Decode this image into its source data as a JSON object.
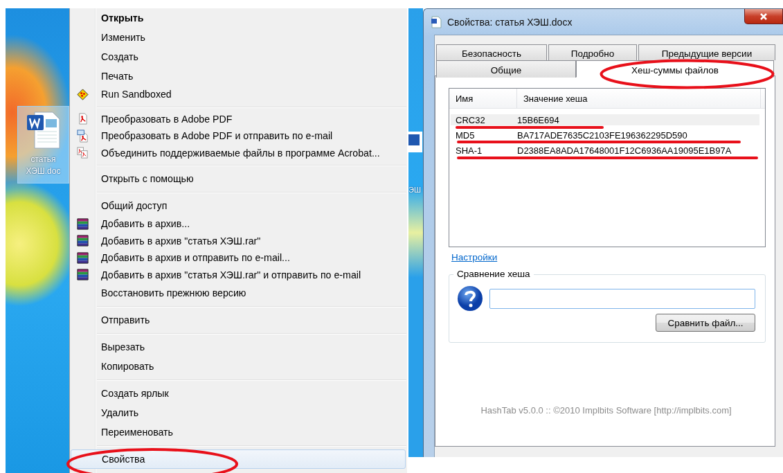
{
  "desktop": {
    "icons": [
      {
        "label": "статья ХЭШ.doc",
        "selected": true
      }
    ],
    "partial_icon_label": "ЭШ"
  },
  "context_menu": {
    "groups": [
      {
        "items": [
          {
            "label": "Открыть",
            "default": true,
            "highlighted": false
          },
          {
            "label": "Изменить",
            "default": false,
            "highlighted": false
          },
          {
            "label": "Создать",
            "default": false,
            "highlighted": false
          },
          {
            "label": "Печать",
            "default": false,
            "highlighted": false
          },
          {
            "label": "Run Sandboxed",
            "kind": "sandbox",
            "default": false,
            "highlighted": false
          }
        ]
      },
      {
        "items": [
          {
            "label": "Преобразовать в Adobe PDF",
            "kind": "pdf",
            "default": false,
            "highlighted": false
          },
          {
            "label": "Преобразовать в Adobe PDF и отправить по e-mail",
            "kind": "pdfmail",
            "default": false,
            "highlighted": false
          },
          {
            "label": "Объединить поддерживаемые файлы в программе Acrobat...",
            "kind": "pdfcombine",
            "default": false,
            "highlighted": false
          }
        ]
      },
      {
        "items": [
          {
            "label": "Открыть с помощью",
            "default": false,
            "highlighted": false
          }
        ]
      },
      {
        "items": [
          {
            "label": "Общий доступ",
            "default": false,
            "highlighted": false
          },
          {
            "label": "Добавить в архив...",
            "kind": "archive",
            "default": false,
            "highlighted": false
          },
          {
            "label": "Добавить в архив \"статья ХЭШ.rar\"",
            "kind": "archive",
            "default": false,
            "highlighted": false
          },
          {
            "label": "Добавить в архив и отправить по e-mail...",
            "kind": "archive",
            "default": false,
            "highlighted": false
          },
          {
            "label": "Добавить в архив \"статья ХЭШ.rar\" и отправить по e-mail",
            "kind": "archive",
            "default": false,
            "highlighted": false
          },
          {
            "label": "Восстановить прежнюю версию",
            "default": false,
            "highlighted": false
          }
        ]
      },
      {
        "items": [
          {
            "label": "Отправить",
            "default": false,
            "highlighted": false
          }
        ]
      },
      {
        "items": [
          {
            "label": "Вырезать",
            "default": false,
            "highlighted": false
          },
          {
            "label": "Копировать",
            "default": false,
            "highlighted": false
          }
        ]
      },
      {
        "items": [
          {
            "label": "Создать ярлык",
            "default": false,
            "highlighted": false
          },
          {
            "label": "Удалить",
            "default": false,
            "highlighted": false
          },
          {
            "label": "Переименовать",
            "default": false,
            "highlighted": false
          }
        ]
      },
      {
        "items": [
          {
            "label": "Свойства",
            "default": false,
            "highlighted": true
          }
        ]
      }
    ]
  },
  "dialog": {
    "title": "Свойства: статья ХЭШ.docx",
    "tab_rows": [
      [
        {
          "label": "Безопасность",
          "selected": false
        },
        {
          "label": "Подробно",
          "selected": false
        },
        {
          "label": "Предыдущие версии",
          "selected": false
        }
      ],
      [
        {
          "label": "Общие",
          "selected": false
        },
        {
          "label": "Хеш-суммы файлов",
          "selected": true
        }
      ]
    ],
    "hash_table": {
      "columns": [
        "Имя",
        "Значение хеша"
      ],
      "rows": [
        {
          "name": "CRC32",
          "value": "15B6E694",
          "selected": true
        },
        {
          "name": "MD5",
          "value": "BA717ADE7635C2103FE196362295D590",
          "selected": false
        },
        {
          "name": "SHA-1",
          "value": "D2388EA8ADA17648001F12C6936AA19095E1B97A",
          "selected": false
        }
      ]
    },
    "settings_link": "Настройки",
    "compare": {
      "legend": "Сравнение хеша",
      "button": "Сравнить файл..."
    },
    "footer": "HashTab v5.0.0 :: ©2010 Implbits Software [http://implbits.com]"
  }
}
